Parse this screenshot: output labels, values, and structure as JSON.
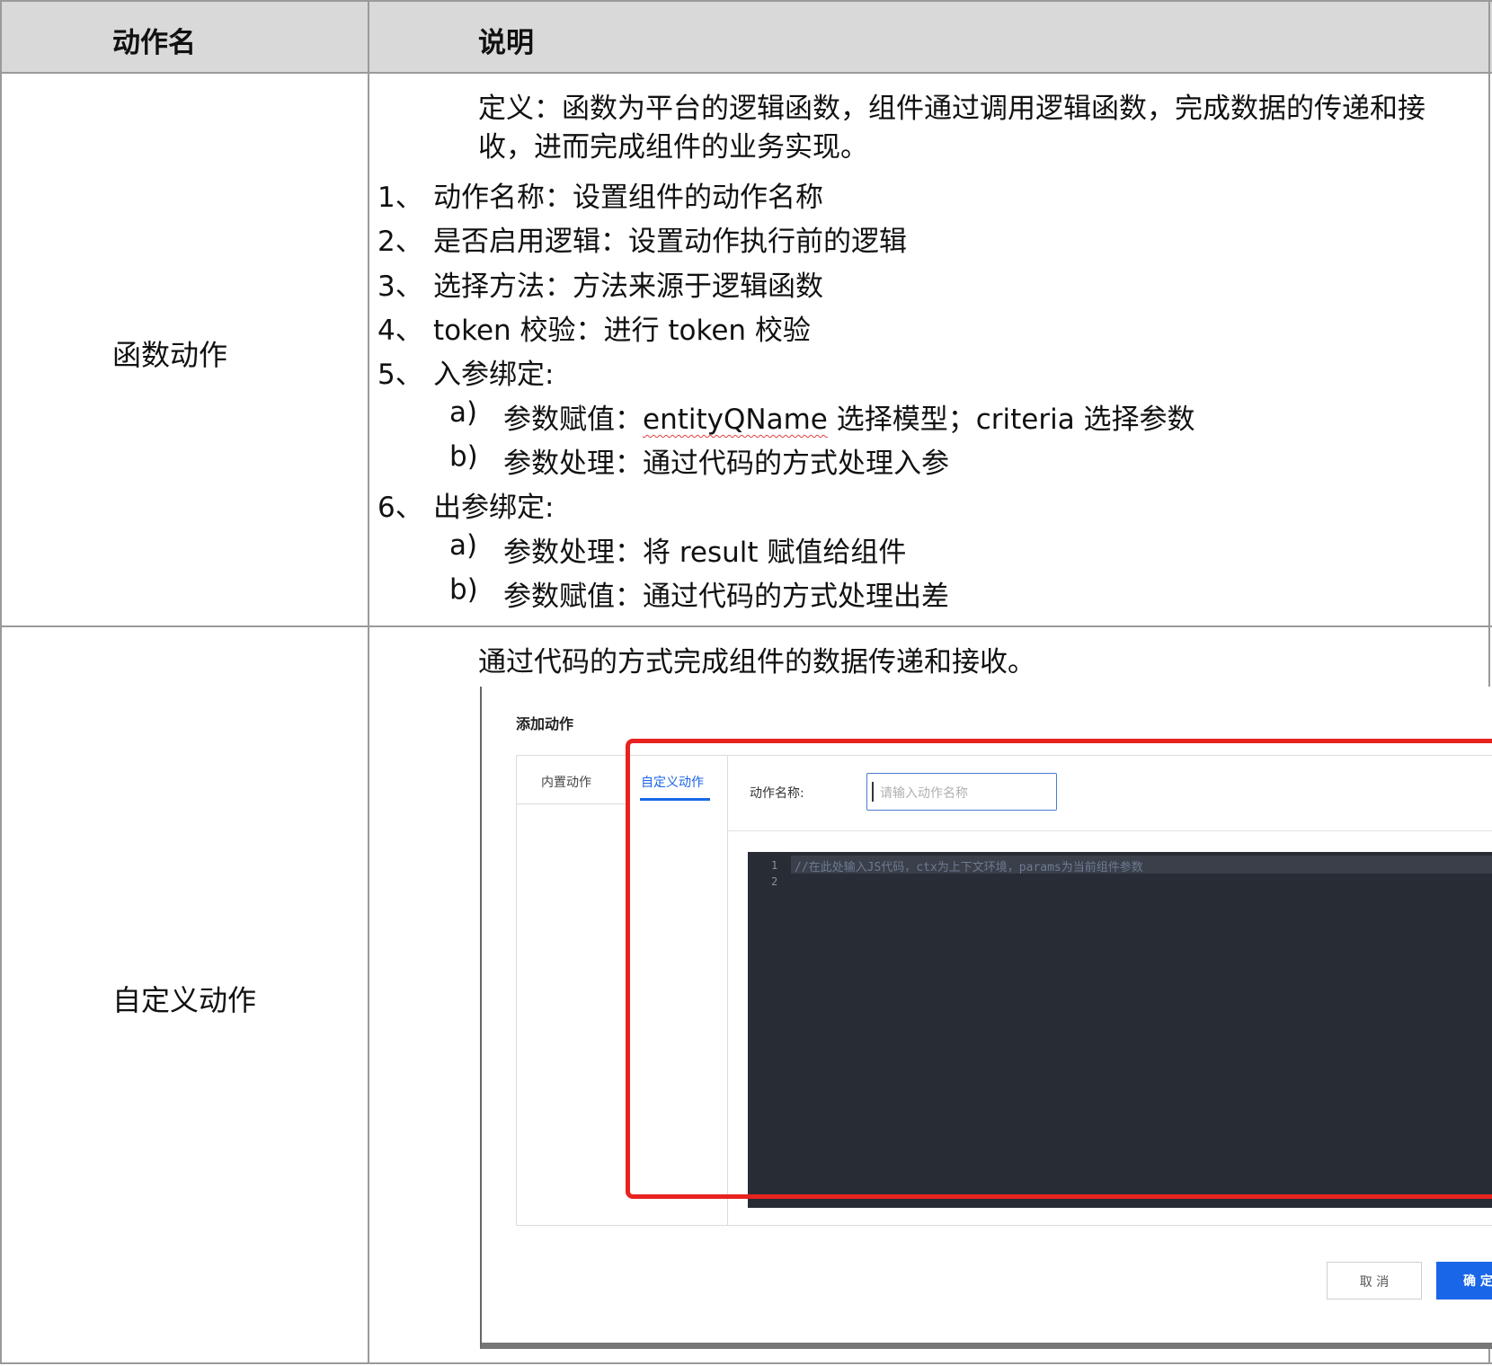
{
  "table": {
    "headers": [
      "动作名",
      "说明"
    ],
    "rows": [
      {
        "name": "函数动作",
        "definition": "定义：函数为平台的逻辑函数，组件通过调用逻辑函数，完成数据的传递和接收，进而完成组件的业务实现。",
        "definition_line1": "定义：函数为平台的逻辑函数，组件通过调用逻辑函数，完成数据的传递和接",
        "definition_line2": "收，进而完成组件的业务实现。",
        "items": [
          {
            "num": "1、",
            "text": "动作名称：设置组件的动作名称"
          },
          {
            "num": "2、",
            "text": "是否启用逻辑：设置动作执行前的逻辑"
          },
          {
            "num": "3、",
            "text": "选择方法：方法来源于逻辑函数"
          },
          {
            "num": "4、",
            "text": "token 校验：进行 token 校验"
          },
          {
            "num": "5、",
            "text": "入参绑定:",
            "sub": [
              {
                "num": "a)",
                "text_pre": "参数赋值：",
                "text_mark": "entityQName",
                "text_post": " 选择模型；criteria 选择参数"
              },
              {
                "num": "b)",
                "text": "参数处理：通过代码的方式处理入参"
              }
            ]
          },
          {
            "num": "6、",
            "text": "出参绑定:",
            "sub": [
              {
                "num": "a)",
                "text": "参数处理：将 result 赋值给组件"
              },
              {
                "num": "b)",
                "text": "参数赋值：通过代码的方式处理出差"
              }
            ]
          }
        ]
      },
      {
        "name": "自定义动作",
        "description": "通过代码的方式完成组件的数据传递和接收。",
        "screenshot": {
          "dialog_title": "添加动作",
          "tabs": [
            {
              "label": "内置动作",
              "active": false
            },
            {
              "label": "自定义动作",
              "active": true
            }
          ],
          "field_label": "动作名称:",
          "field_placeholder": "请输入动作名称",
          "line_numbers": [
            "1",
            "2"
          ],
          "code_line1": "//在此处输入JS代码，ctx为上下文环境，params为当前组件参数",
          "cancel_label": "取 消",
          "ok_label": "确 定",
          "colors": {
            "accent": "#1a66e8",
            "highlight_box": "#e8231f",
            "editor_bg": "#282c34"
          }
        }
      }
    ]
  }
}
